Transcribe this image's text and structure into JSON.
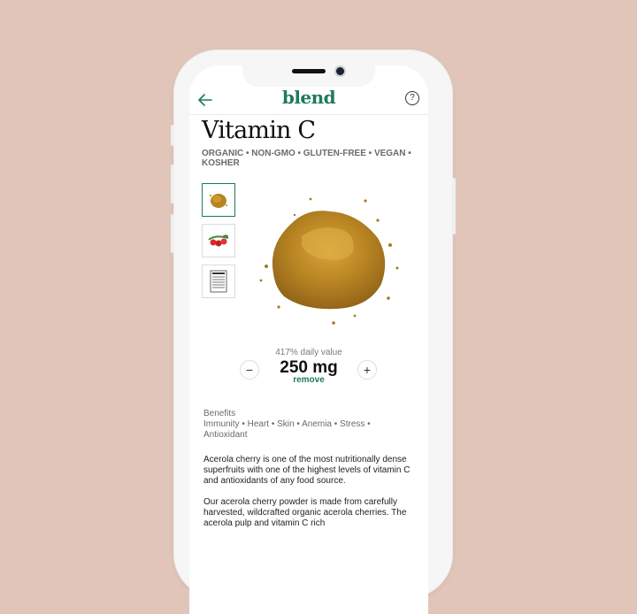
{
  "app": {
    "logo": "blend",
    "back_icon": "arrow-left-icon",
    "help_icon": "question-circle-icon",
    "accent": "#1d7a5b"
  },
  "product": {
    "title": "Vitamin C",
    "tags": "ORGANIC • NON-GMO • GLUTEN-FREE • VEGAN • KOSHER",
    "thumbnails": [
      {
        "label": "powder",
        "active": true
      },
      {
        "label": "acerola cherries",
        "active": false
      },
      {
        "label": "supplement facts label",
        "active": false
      }
    ],
    "daily_value": "417% daily value",
    "quantity": "250 mg",
    "minus": "−",
    "plus": "+",
    "remove": "remove",
    "benefits_label": "Benefits",
    "benefits_list": "Immunity • Heart • Skin • Anemia • Stress • Antioxidant",
    "desc1": "Acerola cherry is one of the most nutritionally dense superfruits with one of the highest levels of vitamin C and antioxidants of any food source.",
    "desc2": "Our acerola cherry powder is made from carefully harvested, wildcrafted organic acerola cherries. The acerola pulp and vitamin C rich"
  }
}
